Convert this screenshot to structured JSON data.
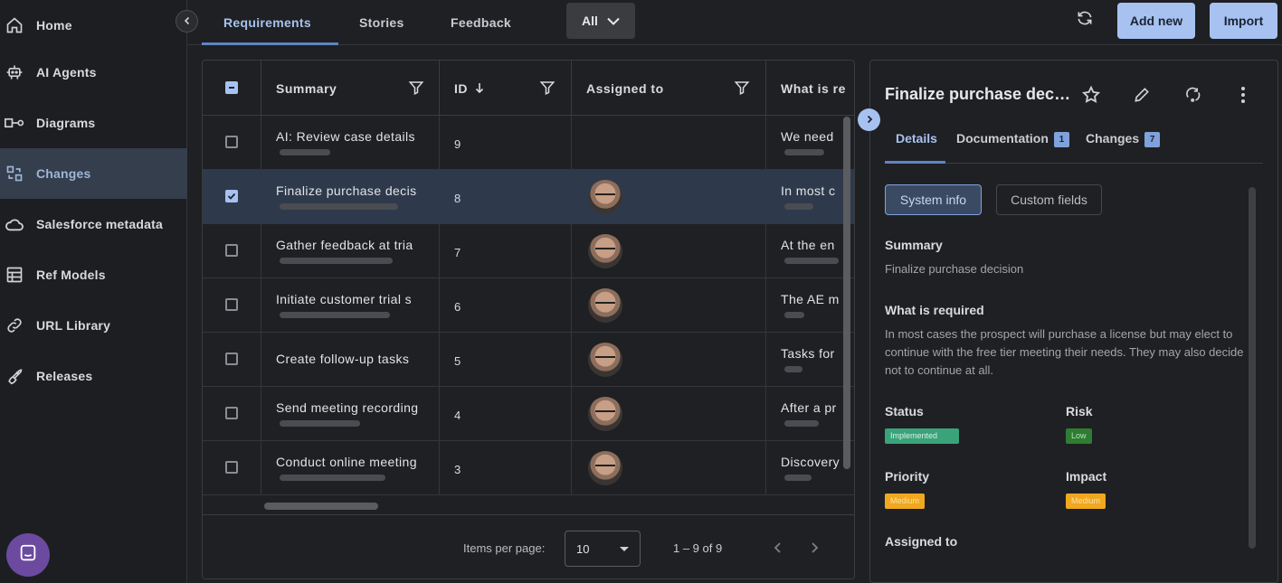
{
  "sidebar": {
    "items": [
      {
        "label": "Home",
        "icon": "home-icon"
      },
      {
        "label": "AI Agents",
        "icon": "robot-icon"
      },
      {
        "label": "Diagrams",
        "icon": "diagram-icon"
      },
      {
        "label": "Changes",
        "icon": "changes-icon"
      },
      {
        "label": "Salesforce metadata",
        "icon": "cloud-icon"
      },
      {
        "label": "Ref Models",
        "icon": "ref-models-icon"
      },
      {
        "label": "URL Library",
        "icon": "link-icon"
      },
      {
        "label": "Releases",
        "icon": "rocket-icon"
      }
    ],
    "active": "Changes"
  },
  "topbar": {
    "tabs": [
      "Requirements",
      "Stories",
      "Feedback"
    ],
    "active_tab": "Requirements",
    "filter_value": "All",
    "add_new_label": "Add new",
    "import_label": "Import"
  },
  "table": {
    "columns": {
      "summary": "Summary",
      "id": "ID",
      "assigned_to": "Assigned to",
      "what_is_required": "What is re"
    },
    "rows": [
      {
        "summary": "AI: Review case details",
        "id": "9",
        "assigned": false,
        "required": "We need",
        "selected": false
      },
      {
        "summary": "Finalize purchase decis",
        "id": "8",
        "assigned": true,
        "required": "In most c",
        "selected": true
      },
      {
        "summary": "Gather feedback at tria",
        "id": "7",
        "assigned": true,
        "required": "At the en",
        "selected": false
      },
      {
        "summary": "Initiate customer trial s",
        "id": "6",
        "assigned": true,
        "required": "The AE m",
        "selected": false
      },
      {
        "summary": "Create follow-up tasks",
        "id": "5",
        "assigned": true,
        "required": "Tasks for",
        "selected": false
      },
      {
        "summary": "Send meeting recording",
        "id": "4",
        "assigned": true,
        "required": "After a pr",
        "selected": false
      },
      {
        "summary": "Conduct online meeting",
        "id": "3",
        "assigned": true,
        "required": "Discovery",
        "selected": false
      }
    ],
    "footer": {
      "items_per_page_label": "Items per page:",
      "items_per_page_value": "10",
      "range_label": "1 – 9 of 9"
    }
  },
  "detail": {
    "title": "Finalize purchase decisi...",
    "tabs": [
      {
        "label": "Details",
        "badge": ""
      },
      {
        "label": "Documentation",
        "badge": "1"
      },
      {
        "label": "Changes",
        "badge": "7"
      }
    ],
    "active_tab": "Details",
    "system_info_label": "System info",
    "custom_fields_label": "Custom fields",
    "summary_label": "Summary",
    "summary_value": "Finalize purchase decision",
    "required_label": "What is required",
    "required_value": "In most cases the prospect will purchase a license but may elect to continue with the free tier meeting their needs. They may also decide not to continue at all.",
    "status_label": "Status",
    "status_value": "Implemented",
    "status_color": "#3aa37a",
    "risk_label": "Risk",
    "risk_value": "Low",
    "risk_color": "#2e7d32",
    "priority_label": "Priority",
    "priority_value": "Medium",
    "priority_color": "#f0a820",
    "impact_label": "Impact",
    "impact_value": "Medium",
    "impact_color": "#f0a820",
    "assigned_label": "Assigned to"
  }
}
